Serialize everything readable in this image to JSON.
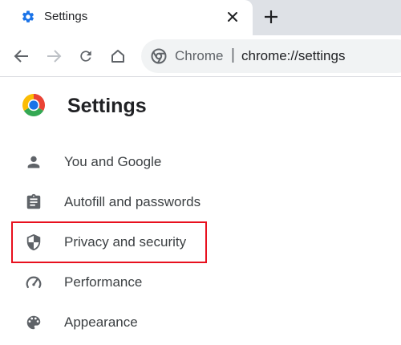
{
  "tab": {
    "title": "Settings",
    "favicon": "gear-icon",
    "favicon_color": "#1a73e8"
  },
  "toolbar": {
    "omnibox": {
      "chip_label": "Chrome",
      "separator": "|",
      "url": "chrome://settings"
    }
  },
  "page": {
    "title": "Settings"
  },
  "sidebar": {
    "items": [
      {
        "label": "You and Google",
        "icon": "person-icon"
      },
      {
        "label": "Autofill and passwords",
        "icon": "clipboard-icon"
      },
      {
        "label": "Privacy and security",
        "icon": "shield-icon",
        "highlighted": true
      },
      {
        "label": "Performance",
        "icon": "speedometer-icon"
      },
      {
        "label": "Appearance",
        "icon": "palette-icon"
      }
    ]
  },
  "colors": {
    "highlight_border": "#e8101e",
    "tabstrip_bg": "#dee1e6",
    "omnibox_bg": "#f1f3f4",
    "icon_gray": "#5f6368"
  }
}
